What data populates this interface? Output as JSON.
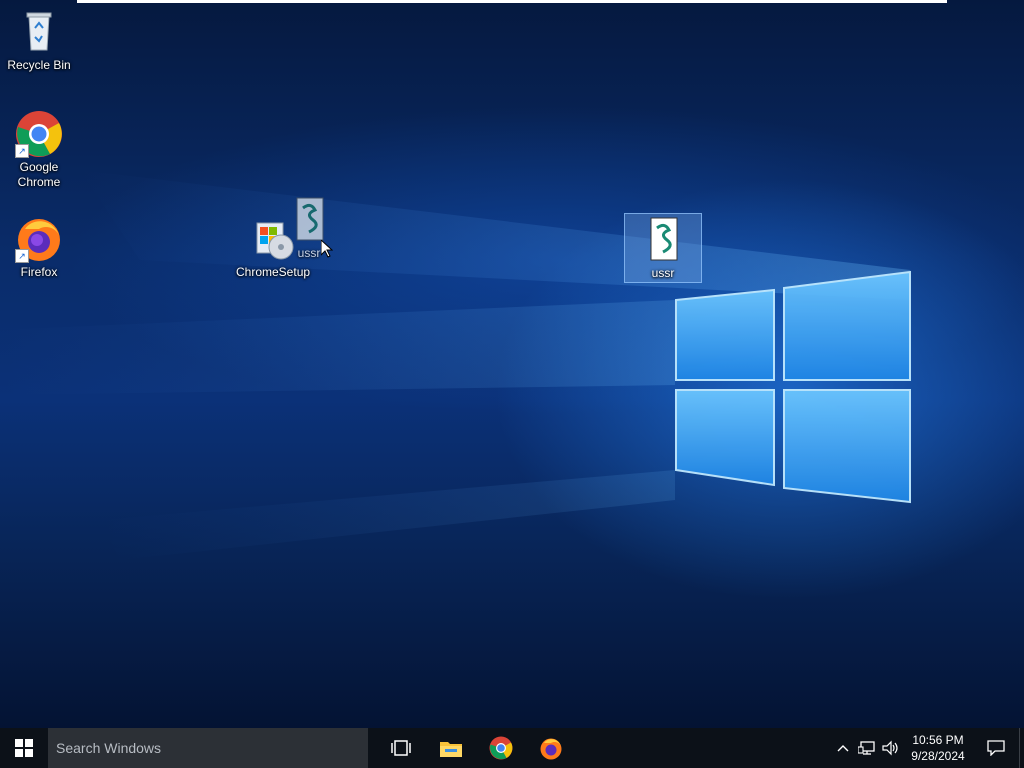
{
  "desktop": {
    "icons": [
      {
        "label": "Recycle Bin",
        "icon": "recycle-bin-icon"
      },
      {
        "label": "Google Chrome",
        "icon": "chrome-icon"
      },
      {
        "label": "Firefox",
        "icon": "firefox-icon"
      },
      {
        "label": "ChromeSetup",
        "icon": "installer-icon"
      },
      {
        "label": "ussr",
        "icon": "script-file-icon"
      }
    ],
    "drag_ghost_label": "ussr"
  },
  "taskbar": {
    "search_placeholder": "Search Windows",
    "pinned": [
      "task-view-icon",
      "file-explorer-icon",
      "chrome-icon",
      "firefox-icon"
    ],
    "clock_time": "10:56 PM",
    "clock_date": "9/28/2024"
  }
}
